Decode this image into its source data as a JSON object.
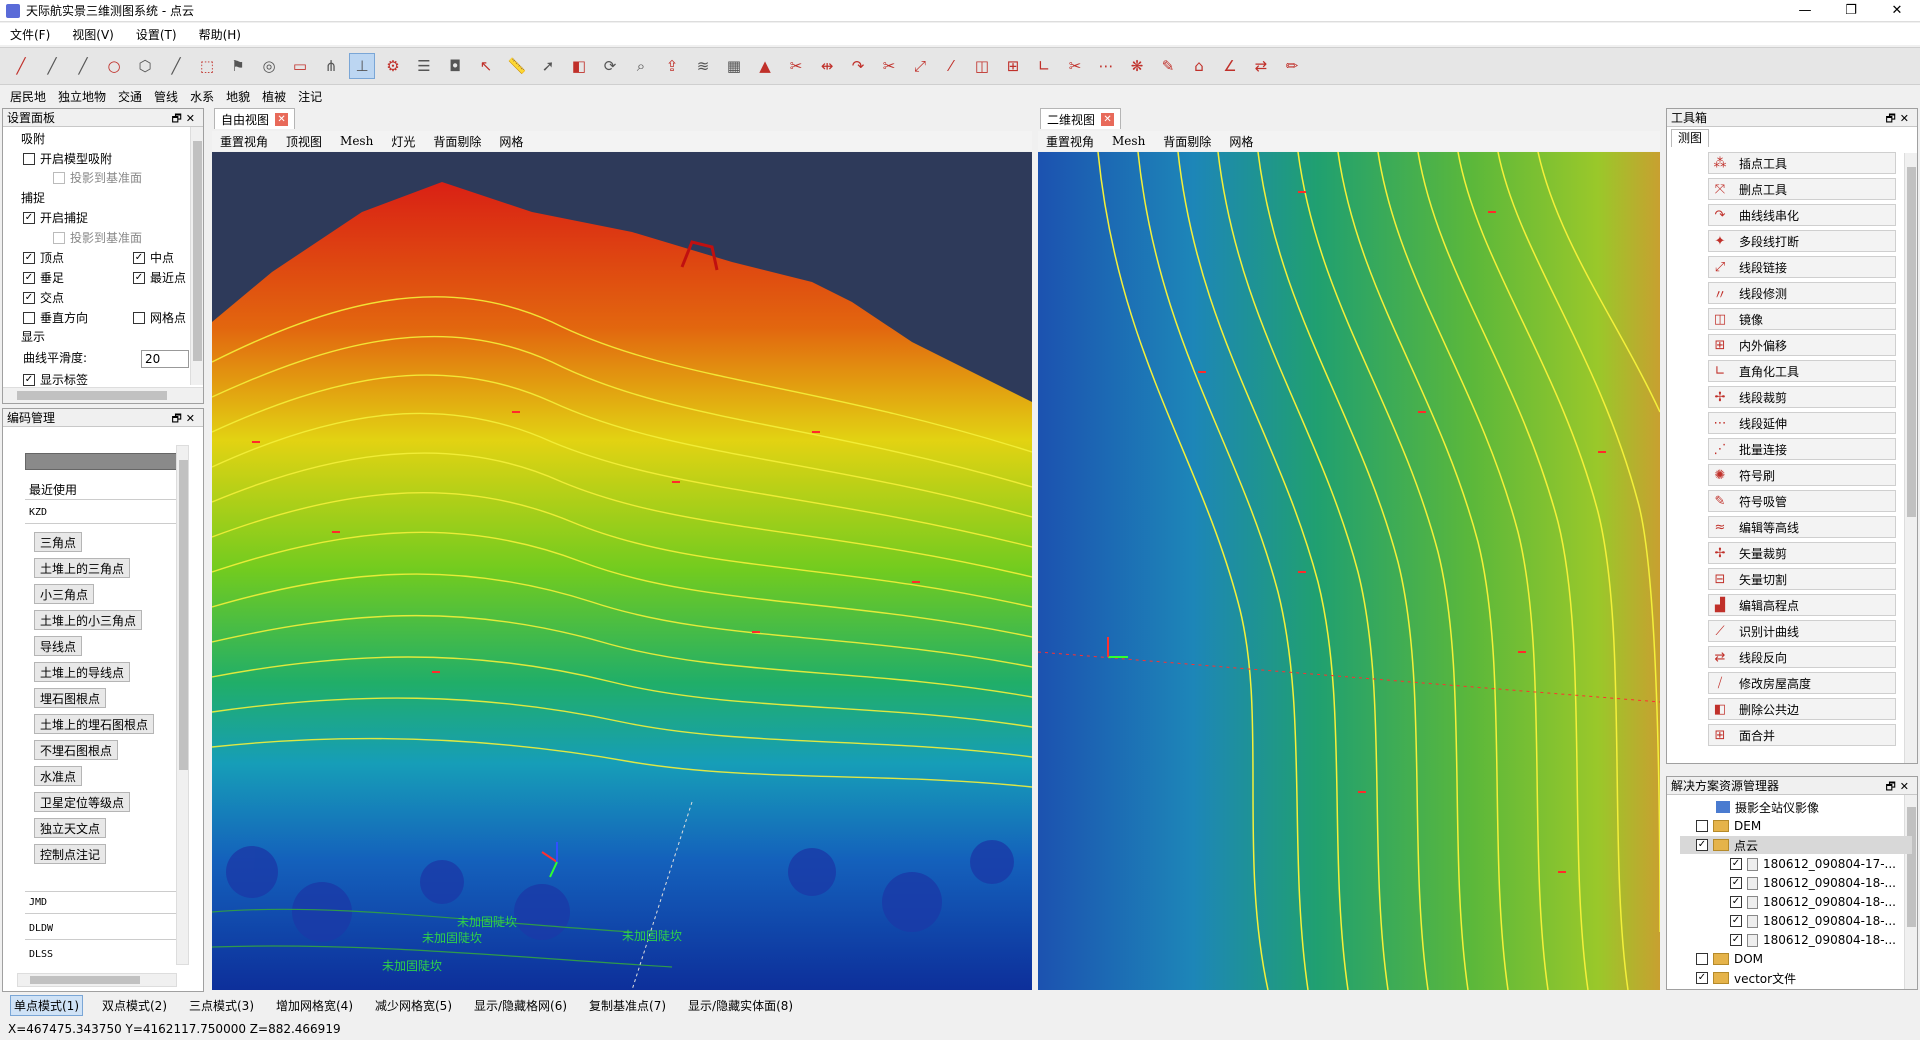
{
  "window": {
    "title": "天际航实景三维测图系统 - 点云",
    "controls": [
      "—",
      "❐",
      "✕"
    ]
  },
  "menu": [
    "文件(F)",
    "视图(V)",
    "设置(T)",
    "帮助(H)"
  ],
  "layers": [
    "居民地",
    "独立地物",
    "交通",
    "管线",
    "水系",
    "地貌",
    "植被",
    "注记"
  ],
  "toolbar_icons": [
    "line-tool-icon",
    "line-tool-icon",
    "line-tool-icon",
    "circle-icon",
    "hexagon-icon",
    "line-tool-icon",
    "select-rect-icon",
    "flag-icon",
    "target-icon",
    "rectangle-icon",
    "node-icon",
    "snap-icon",
    "settings-cog-icon",
    "layers-icon",
    "camera-icon",
    "cursor-icon",
    "ruler-icon",
    "arrow-icon",
    "eraser-icon",
    "rotate-icon",
    "search-icon",
    "export-icon",
    "contour-icon",
    "grid-icon",
    "mountain-icon",
    "split-icon",
    "break-icon",
    "curve-icon",
    "trim-icon",
    "link-icon",
    "repair-icon",
    "mirror-icon",
    "offset-icon",
    "right-angle-icon",
    "clip-icon",
    "batch-icon",
    "symbol-icon",
    "symbol-pick-icon",
    "house-icon",
    "measure-icon",
    "reverse-icon",
    "pencil-icon"
  ],
  "settings_panel": {
    "title": "设置面板",
    "snap_title": "吸附",
    "enable_model_snap": "开启模型吸附",
    "project_base": "投影到基准面",
    "capture_title": "捕捉",
    "enable_capture": "开启捕捉",
    "project_base2": "投影到基准面",
    "vertex": "顶点",
    "midpoint": "中点",
    "perpendicular": "垂足",
    "nearest": "最近点",
    "intersection": "交点",
    "vertical": "垂直方向",
    "gridpoint": "网格点",
    "display_title": "显示",
    "smoothness_label": "曲线平滑度:",
    "smoothness_value": "20",
    "show_labels": "显示标签"
  },
  "code_panel": {
    "title": "编码管理",
    "recent": "最近使用",
    "group1": "KZD",
    "items": [
      "三角点",
      "土堆上的三角点",
      "小三角点",
      "土堆上的小三角点",
      "导线点",
      "土堆上的导线点",
      "埋石图根点",
      "土堆上的埋石图根点",
      "不埋石图根点",
      "水准点",
      "卫星定位等级点",
      "独立天文点",
      "控制点注记"
    ],
    "group2": "JMD",
    "group3": "DLDW",
    "group4": "DLSS"
  },
  "views": {
    "free": {
      "tab": "自由视图",
      "tools": [
        "重置视角",
        "顶视图",
        "Mesh",
        "灯光",
        "背面剔除",
        "网格"
      ],
      "annotations": [
        "未加固陡坎",
        "未加固陡坎",
        "未加固陡坎",
        "未加固陡坎"
      ]
    },
    "ortho": {
      "tab": "二维视图",
      "tools": [
        "重置视角",
        "Mesh",
        "背面剔除",
        "网格"
      ]
    }
  },
  "toolbox": {
    "title": "工具箱",
    "tab": "测图",
    "tools": [
      {
        "label": "插点工具",
        "icon": "insert-point-icon"
      },
      {
        "label": "删点工具",
        "icon": "delete-point-icon"
      },
      {
        "label": "曲线线串化",
        "icon": "curve-icon"
      },
      {
        "label": "多段线打断",
        "icon": "break-icon"
      },
      {
        "label": "线段链接",
        "icon": "link-icon"
      },
      {
        "label": "线段修测",
        "icon": "repair-icon"
      },
      {
        "label": "镜像",
        "icon": "mirror-icon"
      },
      {
        "label": "内外偏移",
        "icon": "offset-icon"
      },
      {
        "label": "直角化工具",
        "icon": "right-angle-icon"
      },
      {
        "label": "线段裁剪",
        "icon": "clip-icon"
      },
      {
        "label": "线段延伸",
        "icon": "extend-icon"
      },
      {
        "label": "批量连接",
        "icon": "batch-icon"
      },
      {
        "label": "符号刷",
        "icon": "brush-icon"
      },
      {
        "label": "符号吸管",
        "icon": "pipette-icon"
      },
      {
        "label": "编辑等高线",
        "icon": "contour-icon"
      },
      {
        "label": "矢量裁剪",
        "icon": "vector-clip-icon"
      },
      {
        "label": "矢量切割",
        "icon": "vector-cut-icon"
      },
      {
        "label": "编辑高程点",
        "icon": "elevation-icon"
      },
      {
        "label": "识别计曲线",
        "icon": "recognize-icon"
      },
      {
        "label": "线段反向",
        "icon": "reverse-icon"
      },
      {
        "label": "修改房屋高度",
        "icon": "house-height-icon"
      },
      {
        "label": "删除公共边",
        "icon": "delete-edge-icon"
      },
      {
        "label": "面合并",
        "icon": "merge-icon"
      }
    ]
  },
  "solution": {
    "title": "解决方案资源管理器",
    "items": [
      {
        "label": "摄影全站仪影像",
        "type": "photo",
        "checked": null
      },
      {
        "label": "DEM",
        "type": "folder",
        "checked": false
      },
      {
        "label": "点云",
        "type": "folder",
        "checked": true,
        "selected": true
      },
      {
        "label": "180612_090804-17-...",
        "type": "file",
        "checked": true
      },
      {
        "label": "180612_090804-18-...",
        "type": "file",
        "checked": true
      },
      {
        "label": "180612_090804-18-...",
        "type": "file",
        "checked": true
      },
      {
        "label": "180612_090804-18-...",
        "type": "file",
        "checked": true
      },
      {
        "label": "180612_090804-18-...",
        "type": "file",
        "checked": true
      },
      {
        "label": "DOM",
        "type": "folder",
        "checked": false
      },
      {
        "label": "vector文件",
        "type": "folder",
        "checked": true
      }
    ]
  },
  "status": {
    "modes": [
      "单点模式(1)",
      "双点模式(2)",
      "三点模式(3)",
      "增加网格宽(4)",
      "减少网格宽(5)",
      "显示/隐藏格网(6)",
      "复制基准点(7)",
      "显示/隐藏实体面(8)"
    ],
    "active_mode": 0,
    "coords": "X=467475.343750  Y=4162117.750000  Z=882.466919"
  }
}
